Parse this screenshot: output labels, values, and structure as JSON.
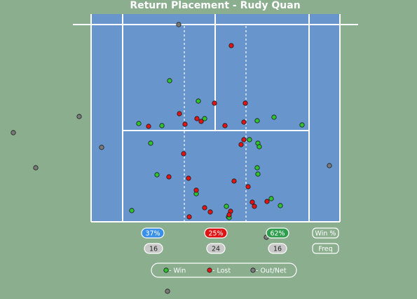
{
  "chart_data": {
    "type": "scatter",
    "title": "Return Placement - Rudy Quan",
    "x": [],
    "series": [
      {
        "name": "Win",
        "color": "#2ec22e",
        "points": [
          [
            242,
            115
          ],
          [
            283,
            144
          ],
          [
            292,
            169
          ],
          [
            367,
            172
          ],
          [
            391,
            167
          ],
          [
            431,
            178
          ],
          [
            198,
            176
          ],
          [
            231,
            179
          ],
          [
            215,
            204
          ],
          [
            356,
            199
          ],
          [
            368,
            204
          ],
          [
            370,
            209
          ],
          [
            367,
            239
          ],
          [
            368,
            248
          ],
          [
            224,
            249
          ],
          [
            280,
            276
          ],
          [
            387,
            283
          ],
          [
            400,
            293
          ],
          [
            323,
            294
          ],
          [
            188,
            300
          ],
          [
            326,
            309
          ],
          [
            327,
            310
          ]
        ]
      },
      {
        "name": "Lost",
        "color": "#e01414",
        "points": [
          [
            330,
            65
          ],
          [
            256,
            162
          ],
          [
            306,
            147
          ],
          [
            350,
            147
          ],
          [
            281,
            169
          ],
          [
            287,
            173
          ],
          [
            264,
            177
          ],
          [
            212,
            180
          ],
          [
            321,
            179
          ],
          [
            348,
            174
          ],
          [
            348,
            199
          ],
          [
            344,
            206
          ],
          [
            262,
            219
          ],
          [
            241,
            252
          ],
          [
            269,
            254
          ],
          [
            334,
            258
          ],
          [
            354,
            266
          ],
          [
            280,
            271
          ],
          [
            360,
            288
          ],
          [
            381,
            287
          ],
          [
            363,
            294
          ],
          [
            292,
            296
          ],
          [
            329,
            301
          ],
          [
            300,
            302
          ],
          [
            327,
            306
          ],
          [
            270,
            309
          ]
        ]
      },
      {
        "name": "Out/Net",
        "color": "#7a7a7a",
        "points": [
          [
            255,
            35
          ],
          [
            113,
            166
          ],
          [
            19,
            189
          ],
          [
            145,
            210
          ],
          [
            51,
            239
          ],
          [
            470,
            236
          ],
          [
            380,
            338
          ],
          [
            239,
            415
          ]
        ]
      }
    ],
    "zones": [
      {
        "win_pct": "37%",
        "win_pct_color": "#3a8fe8",
        "freq": "16"
      },
      {
        "win_pct": "25%",
        "win_pct_color": "#e01414",
        "freq": "24"
      },
      {
        "win_pct": "62%",
        "win_pct_color": "#2e9e4e",
        "freq": "16"
      }
    ],
    "row_labels": {
      "win_pct": "Win %",
      "freq": "Freq"
    },
    "legend": [
      {
        "label": " - Win",
        "color": "#2ec22e"
      },
      {
        "label": " - Lost",
        "color": "#e01414"
      },
      {
        "label": " - Out/Net",
        "color": "#7a7a7a"
      }
    ],
    "colors": {
      "background": "#8aae8e",
      "court": "#6896cc",
      "lines": "#ffffff"
    }
  }
}
